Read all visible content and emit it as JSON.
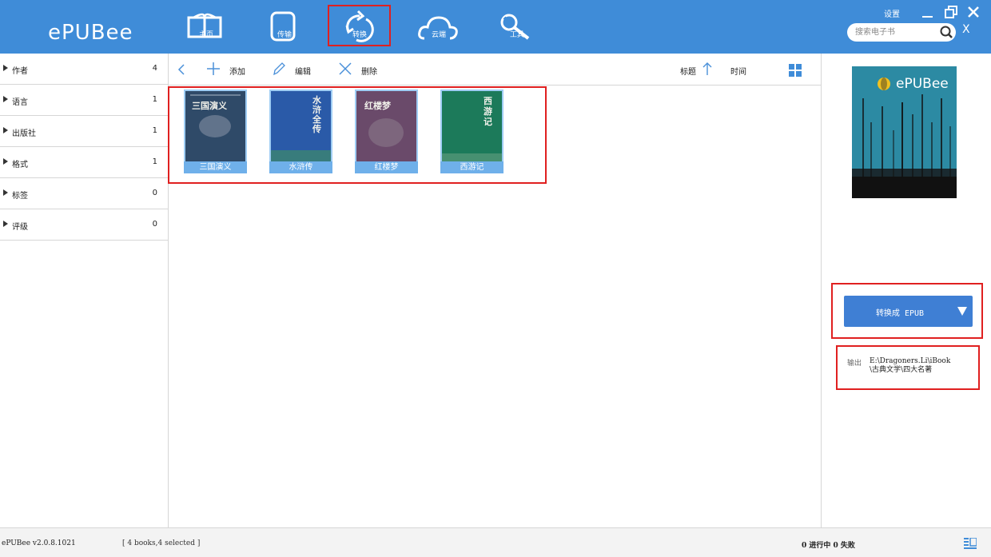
{
  "header": {
    "brand": "ePUBee",
    "nav": [
      {
        "label": "主页",
        "icon": "book-icon"
      },
      {
        "label": "传输",
        "icon": "tablet-icon"
      },
      {
        "label": "转换",
        "icon": "convert-icon"
      },
      {
        "label": "云端",
        "icon": "cloud-icon"
      },
      {
        "label": "工具",
        "icon": "tools-icon"
      }
    ],
    "settings_label": "设置",
    "search_placeholder": "搜索电子书",
    "search_clear": "X"
  },
  "sidebar": {
    "filters": [
      {
        "name": "作者",
        "count": "4"
      },
      {
        "name": "语言",
        "count": "1"
      },
      {
        "name": "出版社",
        "count": "1"
      },
      {
        "name": "格式",
        "count": "1"
      },
      {
        "name": "标签",
        "count": "0"
      },
      {
        "name": "评级",
        "count": "0"
      }
    ]
  },
  "toolbar": {
    "add": "添加",
    "edit": "编辑",
    "delete": "删除",
    "sort_title": "标题",
    "sort_time": "时间"
  },
  "books": [
    {
      "title": "三国演义",
      "cover_text": "三国演义",
      "cover_color": "#2f4a68"
    },
    {
      "title": "水浒传",
      "cover_text": "水浒全传",
      "cover_color": "#2a5aa8"
    },
    {
      "title": "红楼梦",
      "cover_text": "红楼梦",
      "cover_color": "#6a4a6a"
    },
    {
      "title": "西游记",
      "cover_text": "西游记",
      "cover_color": "#1c7a5a"
    }
  ],
  "right_panel": {
    "preview_brand": "ePUBee",
    "convert_label": "转换成 EPUB",
    "output_label": "输出",
    "output_path_line1": "E:\\Dragoners.Li\\iBook",
    "output_path_line2": "\\古典文学\\四大名著"
  },
  "status": {
    "version": "ePUBee v2.0.8.1021",
    "selection": "[ 4 books,4 selected ]",
    "progress": "0 进行中  0 失败"
  },
  "colors": {
    "header_bg": "#3f8cd8",
    "accent": "#3f7fd4",
    "highlight": "#e02020"
  }
}
